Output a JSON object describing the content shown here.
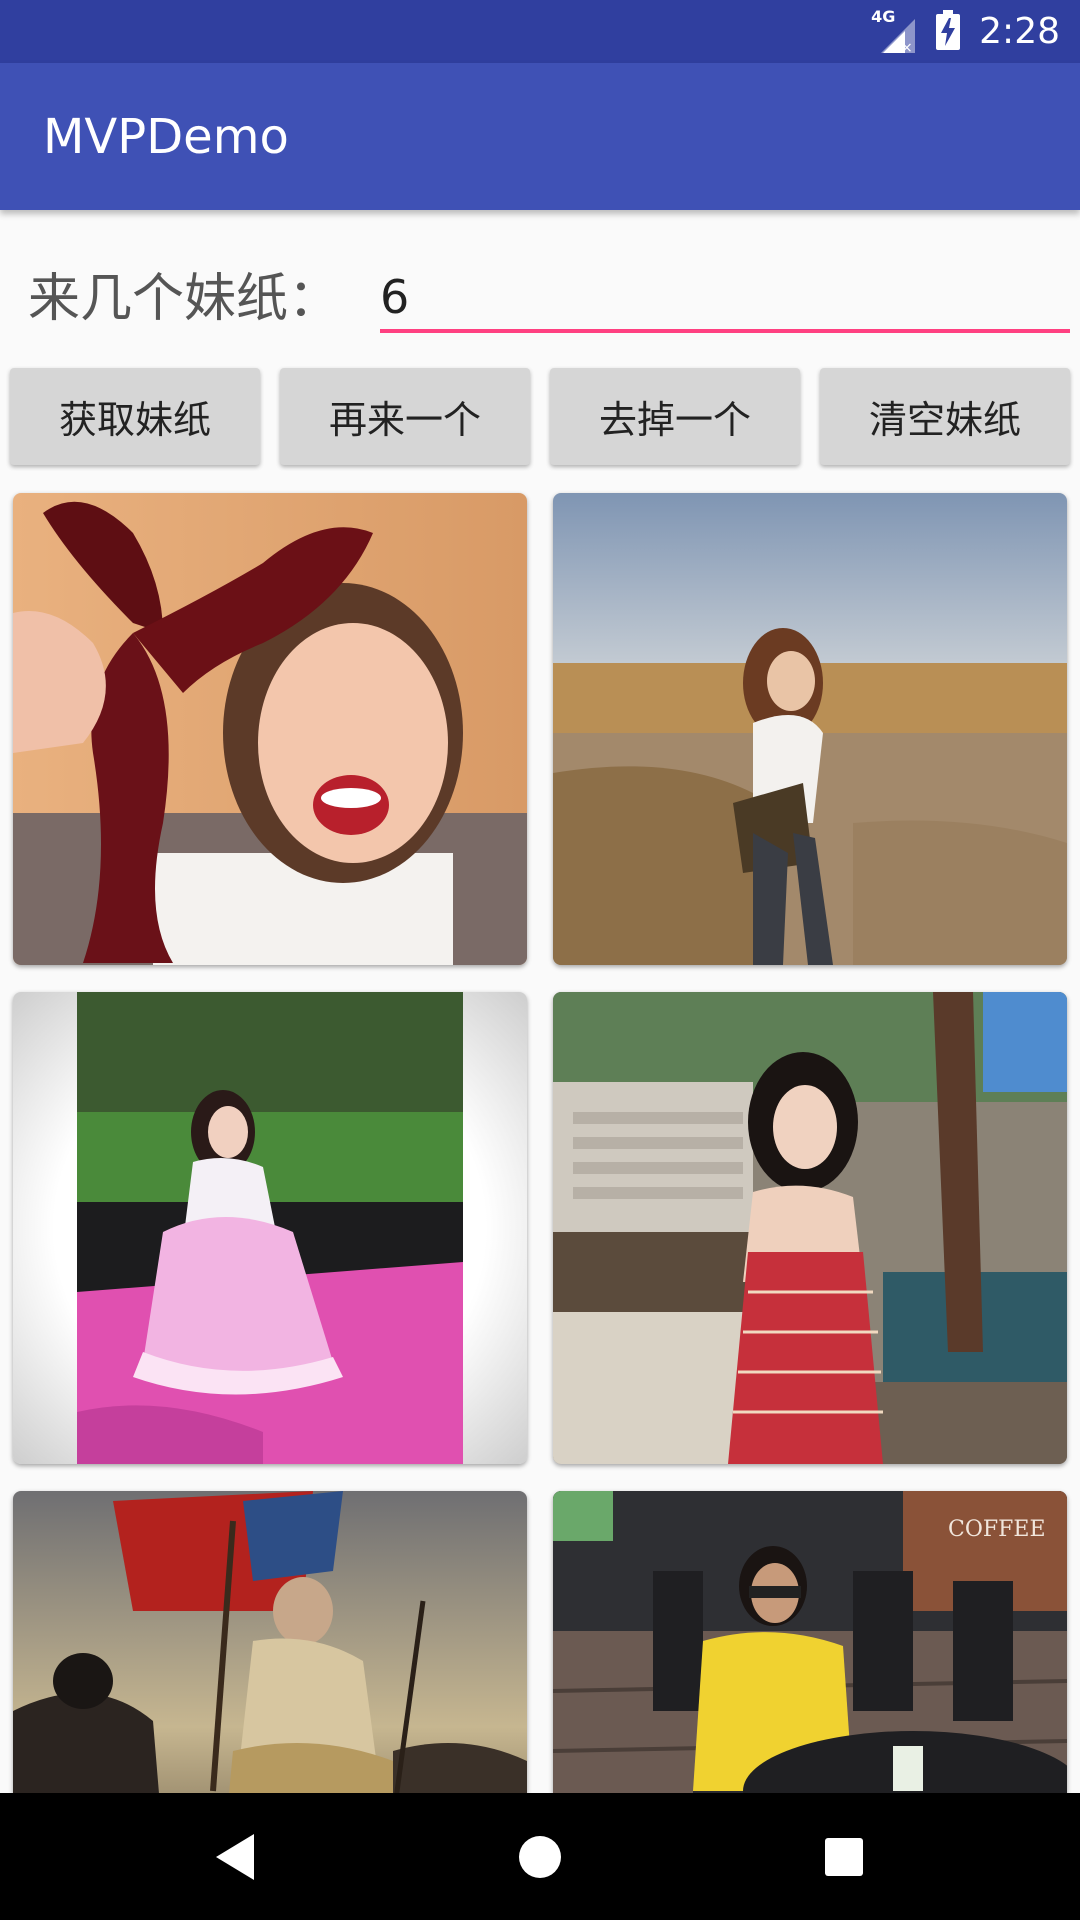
{
  "status_bar": {
    "time": "2:28",
    "network": "4G",
    "icons": [
      "signal-icon",
      "battery-charging-icon"
    ]
  },
  "app_bar": {
    "title": "MVPDemo",
    "color": "#3f51b5",
    "status_color": "#303f9f"
  },
  "form": {
    "label": "来几个妹纸：",
    "count_value": "6",
    "accent": "#ff4081"
  },
  "buttons": {
    "fetch": "获取妹纸",
    "add_one": "再来一个",
    "remove_one": "去掉一个",
    "clear": "清空妹纸"
  },
  "grid": {
    "items": [
      {
        "name": "photo-1",
        "desc": "selfie with lobster toy"
      },
      {
        "name": "photo-2",
        "desc": "girl in field"
      },
      {
        "name": "photo-3",
        "desc": "girl in pink dress on car"
      },
      {
        "name": "photo-4",
        "desc": "girl by pool"
      },
      {
        "name": "photo-5",
        "desc": "painting liberty"
      },
      {
        "name": "photo-6",
        "desc": "girl in cafe"
      }
    ],
    "cafe_sign": "COFFEE"
  },
  "nav_bar": {
    "icons": [
      "back-icon",
      "home-icon",
      "recents-icon"
    ]
  }
}
